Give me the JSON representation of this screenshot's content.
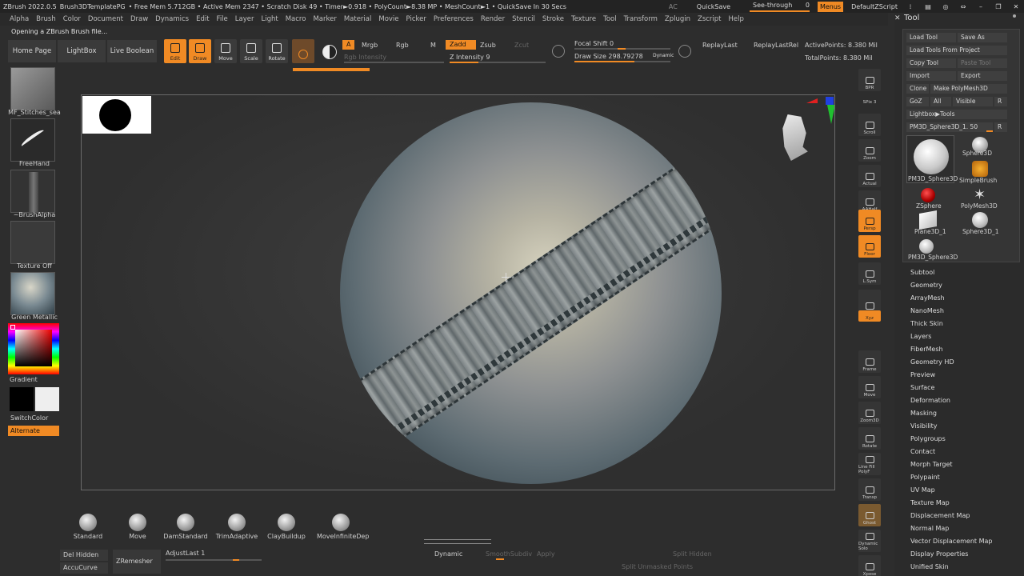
{
  "titlebar": {
    "app": "ZBrush 2022.0.5",
    "doc": "Brush3DTemplatePG",
    "stats": "• Free Mem 5.712GB • Active Mem 2347 • Scratch Disk 49 • Timer►0.918 • PolyCount►8.38 MP • MeshCount►1 • QuickSave In 30 Secs",
    "ac": "AC",
    "quicksave": "QuickSave",
    "seethrough": "See-through",
    "seethrough_val": "0",
    "menus": "Menus",
    "script": "DefaultZScript"
  },
  "menubar": [
    "Alpha",
    "Brush",
    "Color",
    "Document",
    "Draw",
    "Dynamics",
    "Edit",
    "File",
    "Layer",
    "Light",
    "Macro",
    "Marker",
    "Material",
    "Movie",
    "Picker",
    "Preferences",
    "Render",
    "Stencil",
    "Stroke",
    "Texture",
    "Tool",
    "Transform",
    "Zplugin",
    "Zscript",
    "Help"
  ],
  "status": "Opening a ZBrush Brush file...",
  "shelf": {
    "home": "Home Page",
    "lightbox": "LightBox",
    "liveboolean": "Live Boolean",
    "edit": "Edit",
    "draw": "Draw",
    "move": "Move",
    "scale": "Scale",
    "rotate": "Rotate",
    "a": "A",
    "mrgb": "Mrgb",
    "rgb": "Rgb",
    "m": "M",
    "zadd": "Zadd",
    "zsub": "Zsub",
    "zcut": "Zcut",
    "rgb_intensity": "Rgb Intensity",
    "z_intensity": "Z Intensity 9",
    "focal_shift": "Focal Shift 0",
    "draw_size": "Draw Size 298.79278",
    "dynamic": "Dynamic",
    "replaylast": "ReplayLast",
    "replaylastrel": "ReplayLastRel",
    "activepoints": "ActivePoints: 8.380 Mil",
    "totalpoints": "TotalPoints: 8.380 Mil"
  },
  "left": {
    "brush_alpha_name": "MF_Stitches_sea",
    "stroke": "FreeHand",
    "alpha": "~BrushAlpha",
    "texture": "Texture Off",
    "material": "Green Metallic",
    "gradient": "Gradient",
    "switchcolor": "SwitchColor",
    "alternate": "Alternate"
  },
  "righttools": [
    "BPR",
    "SPix 3",
    "Scroll",
    "Zoom",
    "Actual",
    "AAHalf",
    "Persp",
    "Floor",
    "L.Sym",
    "",
    "Xyz",
    "",
    "",
    "Frame",
    "Move",
    "Zoom3D",
    "Rotate",
    "Line Fill PolyF",
    "Transp",
    "Ghost",
    "Dynamic Solo",
    "Xpose"
  ],
  "tool": {
    "title": "Tool",
    "load_tool": "Load Tool",
    "save_as": "Save As",
    "load_from_project": "Load Tools From Project",
    "copy_tool": "Copy Tool",
    "paste_tool": "Paste Tool",
    "import": "Import",
    "export": "Export",
    "clone": "Clone",
    "make_polymesh": "Make PolyMesh3D",
    "goz": "GoZ",
    "all": "All",
    "visible": "Visible",
    "r": "R",
    "lightbox_tools": "Lightbox▶Tools",
    "current_tool": "PM3D_Sphere3D_1. 50",
    "thumbs": [
      "PM3D_Sphere3D",
      "Sphere3D",
      "SimpleBrush",
      "ZSphere",
      "PolyMesh3D",
      "Plane3D_1",
      "Sphere3D_1",
      "PM3D_Sphere3D"
    ],
    "subpalettes": [
      "Subtool",
      "Geometry",
      "ArrayMesh",
      "NanoMesh",
      "Thick Skin",
      "Layers",
      "FiberMesh",
      "Geometry HD",
      "Preview",
      "Surface",
      "Deformation",
      "Masking",
      "Visibility",
      "Polygroups",
      "Contact",
      "Morph Target",
      "Polypaint",
      "UV Map",
      "Texture Map",
      "Displacement Map",
      "Normal Map",
      "Vector Displacement Map",
      "Display Properties",
      "Unified Skin"
    ]
  },
  "brushes": [
    "Standard",
    "Move",
    "DamStandard",
    "TrimAdaptive",
    "ClayBuildup",
    "MoveInfiniteDep"
  ],
  "bottom": {
    "del_hidden": "Del Hidden",
    "accucurve": "AccuCurve",
    "zremesher": "ZRemesher",
    "adjustlast": "AdjustLast 1",
    "dynamic": "Dynamic",
    "smoothsubdiv": "SmoothSubdiv",
    "apply": "Apply",
    "split_hidden": "Split Hidden",
    "split_unmasked": "Split Unmasked Points"
  },
  "colors": {
    "accent": "#f08a24",
    "background": "#2d2d2d"
  }
}
